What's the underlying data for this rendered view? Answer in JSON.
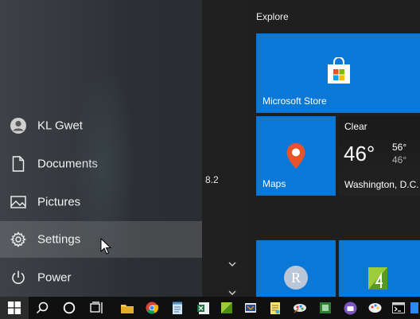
{
  "start_menu": {
    "rail": {
      "user": "KL Gwet",
      "documents": "Documents",
      "pictures": "Pictures",
      "settings": "Settings",
      "power": "Power"
    },
    "applist": {
      "version_text": "8.2"
    },
    "tiles": {
      "group_title": "Explore",
      "store_label": "Microsoft Store",
      "maps_label": "Maps",
      "weather": {
        "condition": "Clear",
        "temperature": "46°",
        "high": "56°",
        "low": "46°",
        "city": "Washington, D.C."
      },
      "r_letter": "R"
    }
  },
  "taskbar": {
    "icons": [
      "windows-start-icon",
      "search-icon",
      "cortana-icon",
      "task-view-icon",
      "file-explorer-icon",
      "chrome-icon",
      "notepad-icon",
      "excel-icon",
      "app-icon",
      "app-icon",
      "app-icon",
      "app-icon",
      "app-icon",
      "app-icon",
      "app-icon",
      "app-icon",
      "command-prompt-icon",
      "app-icon"
    ]
  },
  "colors": {
    "accent": "#0a78d7",
    "rail_bg": "#363a3e",
    "taskbar_bg": "#101010"
  }
}
